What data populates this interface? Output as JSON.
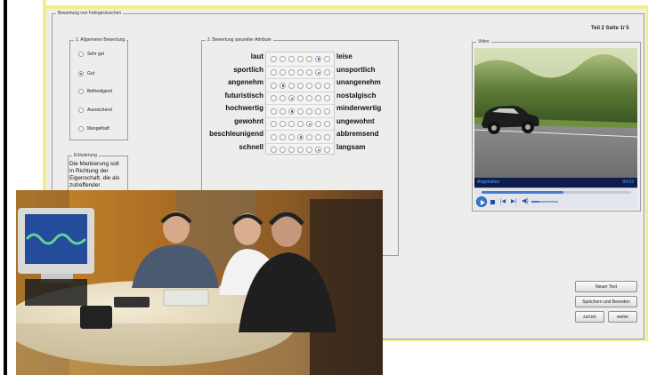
{
  "window": {
    "title": "Bewertung von Fahrgeräuschen",
    "page_indicator": "Teil 2 Seite 1/ 5"
  },
  "overall_rating": {
    "legend": "1. Allgemeine Bewertung",
    "options": [
      {
        "label": "Sehr gut",
        "selected": false
      },
      {
        "label": "Gut",
        "selected": true
      },
      {
        "label": "Befriedigend",
        "selected": false
      },
      {
        "label": "Ausreichend",
        "selected": false
      },
      {
        "label": "Mangelhaft",
        "selected": false
      }
    ]
  },
  "explanation": {
    "legend": "Erläuterung",
    "text": "Die Markierung soll in Richtung der Eigenschaft, die als zutreffender"
  },
  "attribute_rating": {
    "legend": "2. Bewertung spezieller Attribute",
    "scale_points": 7,
    "rows": [
      {
        "left": "laut",
        "right": "leise",
        "selected_index": 5
      },
      {
        "left": "sportlich",
        "right": "unsportlich",
        "selected_index": 5
      },
      {
        "left": "angenehm",
        "right": "unangenehm",
        "selected_index": 1
      },
      {
        "left": "futuristisch",
        "right": "nostalgisch",
        "selected_index": 2
      },
      {
        "left": "hochwertig",
        "right": "minderwertig",
        "selected_index": 2
      },
      {
        "left": "gewohnt",
        "right": "ungewohnt",
        "selected_index": 4
      },
      {
        "left": "beschleunigend",
        "right": "abbremsend",
        "selected_index": 3
      },
      {
        "left": "schnell",
        "right": "langsam",
        "selected_index": 5
      }
    ]
  },
  "video": {
    "legend": "Video",
    "status_text": "Angehalten",
    "time": "00:03",
    "progress": 0.55,
    "volume": 0.3
  },
  "buttons": {
    "new_test": "Neuer Test",
    "save_exit": "Speichern und Beenden",
    "back": "zurück",
    "next": "weiter"
  },
  "colors": {
    "window_border": "#f4ee8a",
    "window_bg": "#ededeb",
    "selected_radio": "#2a5db0",
    "video_status_bg": "#0d1c4a"
  }
}
